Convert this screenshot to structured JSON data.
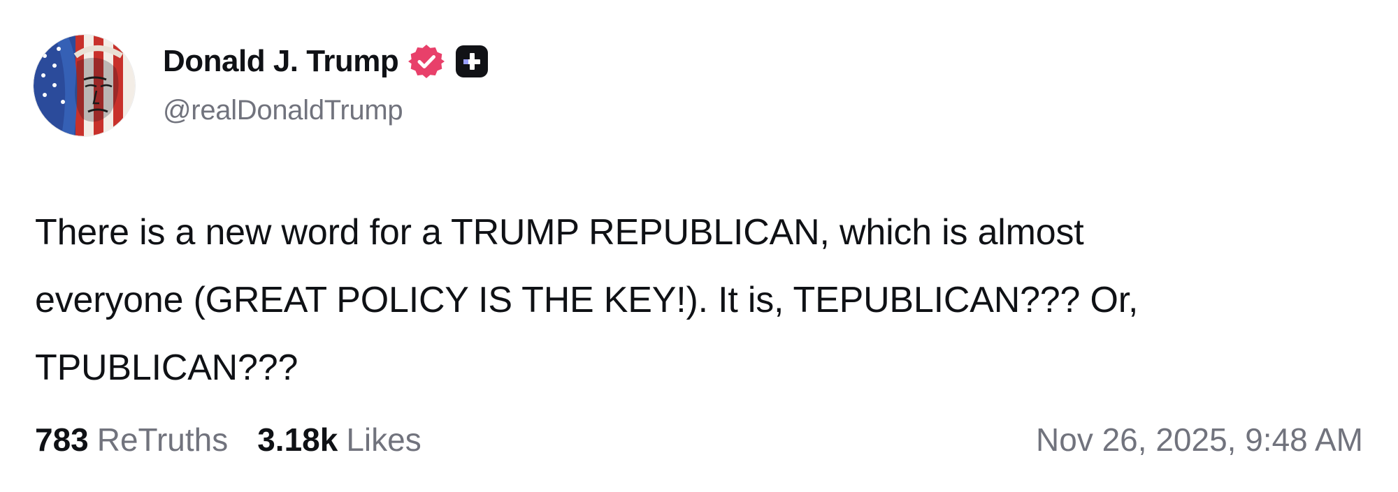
{
  "author": {
    "display_name": "Donald J. Trump",
    "handle": "@realDonaldTrump",
    "avatar_icon": "avatar-flag-portrait",
    "verified_icon": "verified-badge-icon",
    "verified_color": "#e8406a",
    "plus_icon": "plus-badge-icon"
  },
  "post": {
    "lines": [
      "There is a new word for a TRUMP REPUBLICAN, which is almost",
      "everyone (GREAT POLICY IS THE KEY!). It is, TEPUBLICAN??? Or,",
      "TPUBLICAN???"
    ]
  },
  "stats": {
    "retruths_count": "783",
    "retruths_label": "ReTruths",
    "likes_count": "3.18k",
    "likes_label": "Likes",
    "timestamp": "Nov 26, 2025, 9:48 AM"
  }
}
